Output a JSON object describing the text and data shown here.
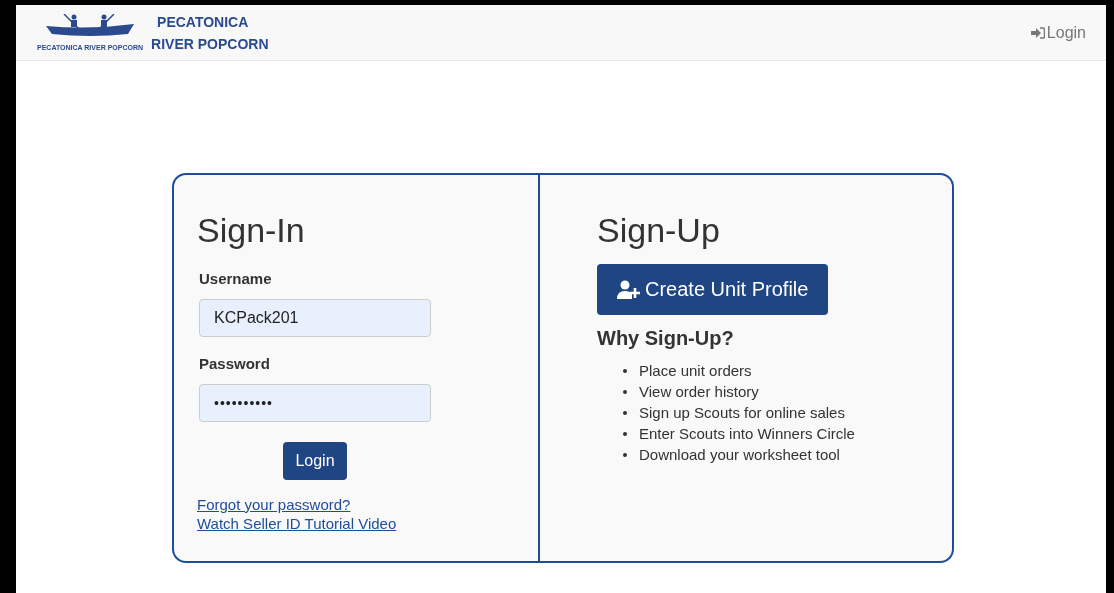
{
  "header": {
    "logo_caption": "PECATONICA RIVER POPCORN",
    "brand_lines": [
      "PECATONICA",
      "RIVER POPCORN"
    ],
    "nav_login": "Login"
  },
  "sign_in": {
    "title": "Sign-In",
    "fields": [
      {
        "label": "Username",
        "value": "KCPack201",
        "kind": "text"
      },
      {
        "label": "Password",
        "value": "••••••••••",
        "kind": "password"
      }
    ],
    "button": "Login",
    "links": [
      "Forgot your password?",
      "Watch Seller ID Tutorial Video"
    ]
  },
  "sign_up": {
    "title": "Sign-Up",
    "button": "Create Unit Profile",
    "subtitle": "Why Sign-Up?",
    "benefits": [
      "Place unit orders",
      "View order history",
      "Sign up Scouts for online sales",
      "Enter Scouts into Winners Circle",
      "Download your worksheet tool"
    ]
  }
}
